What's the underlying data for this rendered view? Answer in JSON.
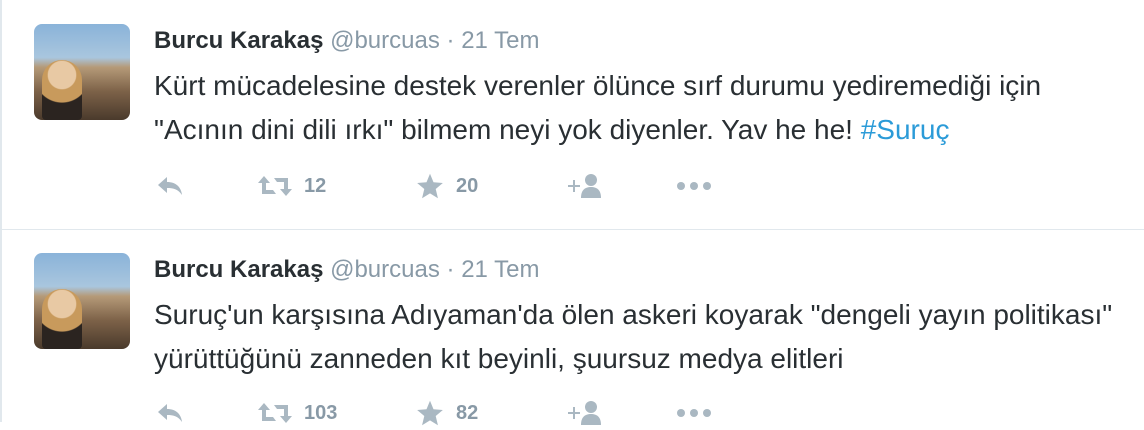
{
  "tweets": [
    {
      "fullname": "Burcu Karakaş",
      "username": "@burcuas",
      "dot": "·",
      "time": "21 Tem",
      "text": "Kürt mücadelesine destek verenler ölünce sırf durumu yediremediği için \"Acının dini dili ırkı\" bilmem neyi yok diyenler. Yav he he! ",
      "hashtag": "#Suruç",
      "retweets": "12",
      "likes": "20"
    },
    {
      "fullname": "Burcu Karakaş",
      "username": "@burcuas",
      "dot": "·",
      "time": "21 Tem",
      "text": "Suruç'un karşısına Adıyaman'da ölen askeri koyarak \"dengeli yayın politikası\" yürüttüğünü zanneden kıt beyinli, şuursuz medya elitleri",
      "hashtag": "",
      "retweets": "103",
      "likes": "82"
    }
  ],
  "icons": {
    "reply": "reply-icon",
    "retweet": "retweet-icon",
    "like": "star-icon",
    "follow": "follow-icon",
    "more": "more-icon"
  },
  "colors": {
    "link": "#2b9bd8",
    "muted": "#8899a6",
    "icon": "#aab8c2",
    "border": "#e1e8ed"
  }
}
